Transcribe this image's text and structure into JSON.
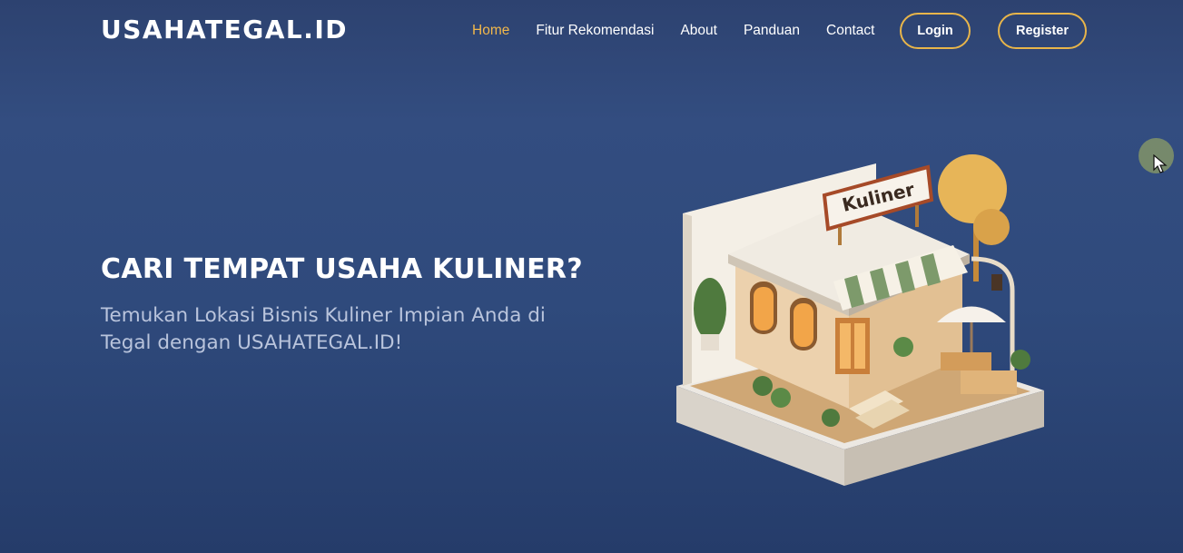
{
  "header": {
    "logo": "USAHATEGAL.ID",
    "nav": [
      {
        "label": "Home",
        "active": true
      },
      {
        "label": "Fitur Rekomendasi"
      },
      {
        "label": "About"
      },
      {
        "label": "Panduan"
      },
      {
        "label": "Contact"
      }
    ],
    "login_label": "Login",
    "register_label": "Register"
  },
  "hero": {
    "title": "CARI TEMPAT USAHA KULINER?",
    "subtitle": "Temukan Lokasi Bisnis Kuliner Impian Anda di Tegal dengan USAHATEGAL.ID!",
    "illustration_sign": "Kuliner"
  },
  "colors": {
    "background": "#2f4a7c",
    "accent": "#f2b84b",
    "button_border": "#e8b54a",
    "subtitle": "#b9c4dc"
  }
}
